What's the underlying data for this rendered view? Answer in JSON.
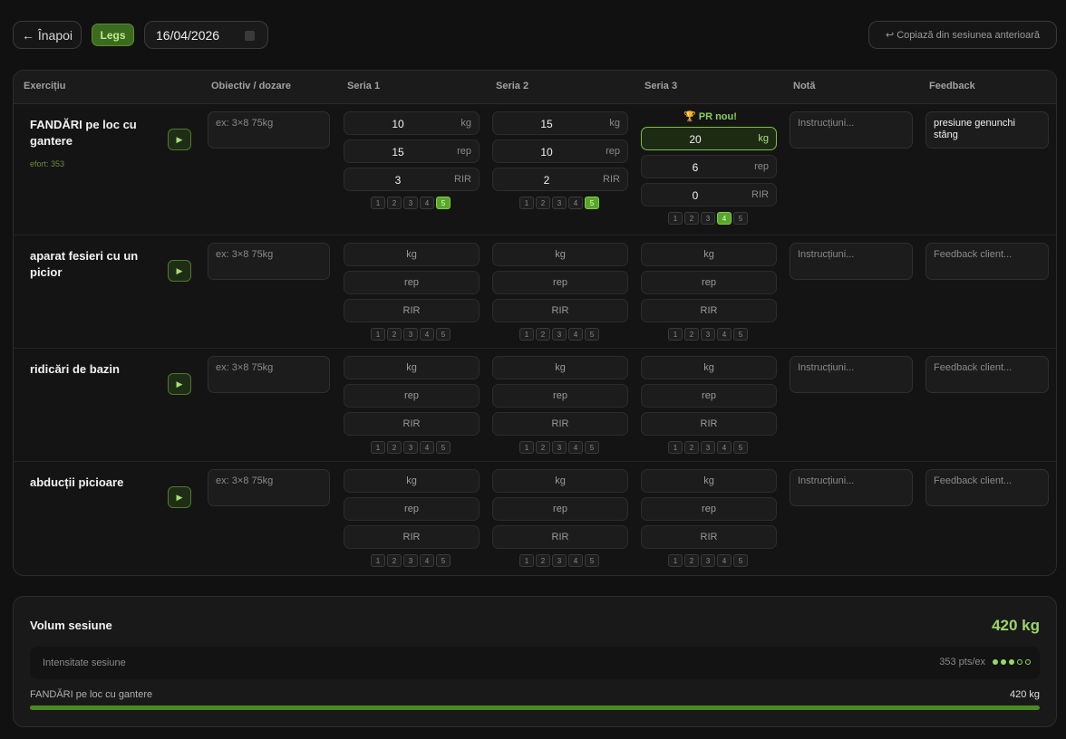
{
  "header": {
    "back_label": "← Înapoi",
    "tag": "Legs",
    "date": "16/04/2026",
    "copy_label": "↩ Copiază din sesiunea anterioară"
  },
  "columns": [
    "Exercițiu",
    "Obiectiv / dozare",
    "Seria 1",
    "Seria 2",
    "Seria 3",
    "Notă",
    "Feedback"
  ],
  "units": {
    "kg": "kg",
    "rep": "rep",
    "rir": "RIR"
  },
  "rpe_scale": [
    "1",
    "2",
    "3",
    "4",
    "5"
  ],
  "exercises": [
    {
      "name": "FANDĂRI pe loc cu gantere",
      "effort": "efort: 353",
      "goal_placeholder": "ex: 3×8 75kg",
      "sets": [
        {
          "kg": "10",
          "rep": "15",
          "rir": "3",
          "rpe": 5
        },
        {
          "kg": "15",
          "rep": "10",
          "rir": "2",
          "rpe": 5
        },
        {
          "kg": "20",
          "rep": "6",
          "rir": "0",
          "rpe": 4,
          "pr": "🏆 PR nou!"
        }
      ],
      "note_placeholder": "Instrucțiuni...",
      "feedback": "presiune genunchi stâng"
    },
    {
      "name": "aparat fesieri cu un picior",
      "goal_placeholder": "ex: 3×8 75kg",
      "sets": [
        {},
        {},
        {}
      ],
      "note_placeholder": "Instrucțiuni...",
      "feedback_placeholder": "Feedback client..."
    },
    {
      "name": "ridicări de bazin",
      "goal_placeholder": "ex: 3×8 75kg",
      "sets": [
        {},
        {},
        {}
      ],
      "note_placeholder": "Instrucțiuni...",
      "feedback_placeholder": "Feedback client..."
    },
    {
      "name": "abducții picioare",
      "goal_placeholder": "ex: 3×8 75kg",
      "sets": [
        {},
        {},
        {}
      ],
      "note_placeholder": "Instrucțiuni...",
      "feedback_placeholder": "Feedback client..."
    }
  ],
  "summary": {
    "title": "Volum sesiune",
    "total": "420 kg",
    "intensity_label": "Intensitate sesiune",
    "intensity_value": "353 pts/ex",
    "intensity_level": 3,
    "intensity_max": 5,
    "exercise_volume": [
      {
        "name": "FANDĂRI pe loc cu gantere",
        "value": "420 kg",
        "fraction": 1.0
      }
    ]
  },
  "colors": {
    "accent": "#9ad66a",
    "accent_dark": "#4a8a21",
    "bg": "#111111"
  }
}
